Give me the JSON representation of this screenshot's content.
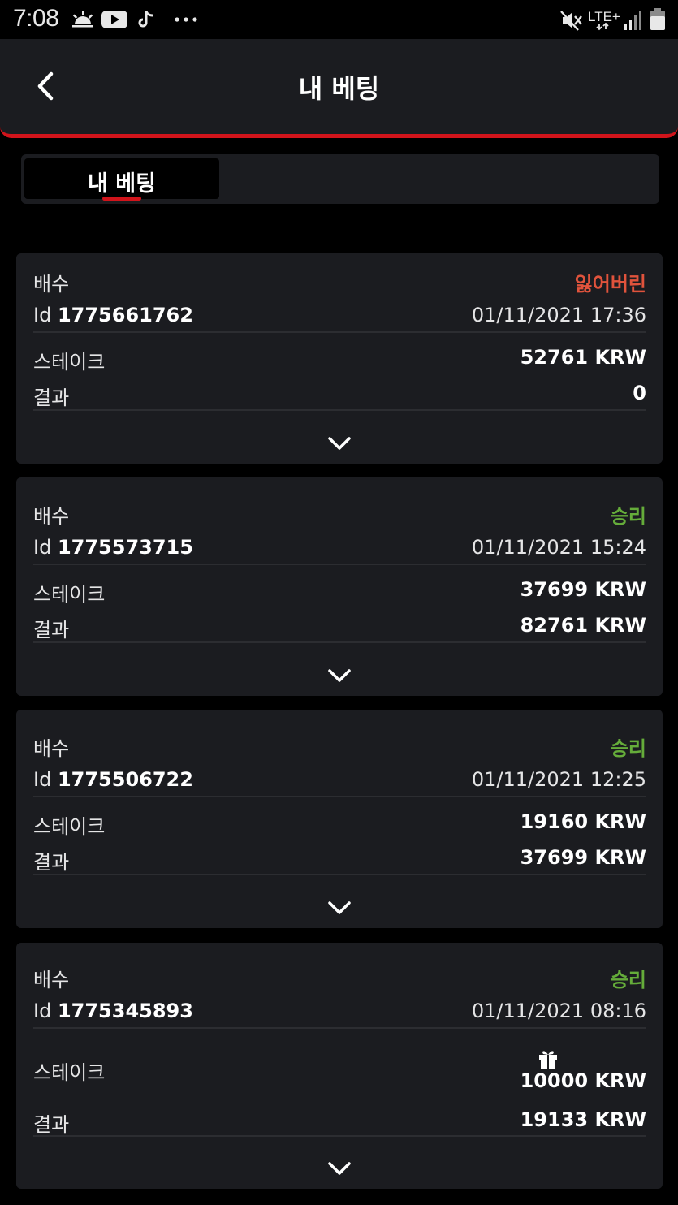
{
  "status_bar": {
    "time": "7:08",
    "left_icons": [
      "weather-icon",
      "youtube-icon",
      "tiktok-icon",
      "more-dots-icon"
    ],
    "right_icons": [
      "mute-icon",
      "lte-icon",
      "signal-icon",
      "battery-icon"
    ],
    "network": "LTE+"
  },
  "header": {
    "title": "내 베팅"
  },
  "tabs": [
    {
      "label": "내 베팅",
      "active": true
    }
  ],
  "bets": [
    {
      "odds_label": "배수",
      "status": "잃어버린",
      "status_type": "lost",
      "id_label": "Id",
      "id": "1775661762",
      "datetime": "01/11/2021 17:36",
      "stake_label": "스테이크",
      "stake": "52761 KRW",
      "result_label": "결과",
      "result": "0"
    },
    {
      "odds_label": "배수",
      "status": "승리",
      "status_type": "won",
      "id_label": "Id",
      "id": "1775573715",
      "datetime": "01/11/2021 15:24",
      "stake_label": "스테이크",
      "stake": "37699 KRW",
      "result_label": "결과",
      "result": "82761 KRW"
    },
    {
      "odds_label": "배수",
      "status": "승리",
      "status_type": "won",
      "id_label": "Id",
      "id": "1775506722",
      "datetime": "01/11/2021 12:25",
      "stake_label": "스테이크",
      "stake": "19160 KRW",
      "result_label": "결과",
      "result": "37699 KRW"
    },
    {
      "odds_label": "배수",
      "status": "승리",
      "status_type": "won",
      "id_label": "Id",
      "id": "1775345893",
      "datetime": "01/11/2021 08:16",
      "stake_label": "스테이크",
      "stake": "10000 KRW",
      "stake_icon": "gift-icon",
      "result_label": "결과",
      "result": "19133 KRW"
    }
  ],
  "colors": {
    "accent": "#d1141b",
    "lost": "#e0533c",
    "won": "#65ac3a",
    "card_bg": "#1b1c20",
    "page_bg": "#000000"
  }
}
